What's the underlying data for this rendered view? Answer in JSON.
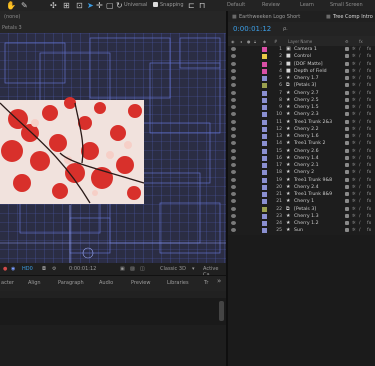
{
  "toolbar": {
    "selection_tool": "selection-arrow",
    "universal_label": "Universal",
    "snapping_label": "Snapping",
    "workspaces": [
      "Default",
      "Review",
      "Learn",
      "Small Screen"
    ]
  },
  "viewer": {
    "composition_label": "(none)",
    "breadcrumb": "Petals 3",
    "footer": {
      "time": "0:00:01:12",
      "renderer": "Classic 3D",
      "active_camera": "Active Ca",
      "draft_label": "HD0"
    }
  },
  "panels": {
    "tabs": [
      "acter",
      "Align",
      "Paragraph",
      "Audio",
      "Preview",
      "Libraries",
      "Tr"
    ],
    "more": "»"
  },
  "timeline": {
    "tabs": [
      "Earthweeken Logo Short",
      "Tree Comp Intro"
    ],
    "timecode": "0:00:01:12",
    "search_placeholder": "ρ.",
    "column_header": {
      "number": "#",
      "layer_name": "Layer Name"
    },
    "layers": [
      {
        "num": "1",
        "name": "Camera 1",
        "color": "#d94fa6",
        "icon": "camera"
      },
      {
        "num": "2",
        "name": "Control",
        "color": "#e8c845",
        "icon": "solid"
      },
      {
        "num": "3",
        "name": "[DOF Matte]",
        "color": "#d94fa6",
        "icon": "solid"
      },
      {
        "num": "4",
        "name": "Depth of Field",
        "color": "#d94fa6",
        "icon": "solid"
      },
      {
        "num": "5",
        "name": "Cherry 1.7",
        "color": "#8a8fd1",
        "icon": "star"
      },
      {
        "num": "6",
        "name": "[Petals 3]",
        "color": "#9aa04f",
        "icon": "comp"
      },
      {
        "num": "7",
        "name": "Cherry 2.7",
        "color": "#8a8fd1",
        "icon": "star"
      },
      {
        "num": "8",
        "name": "Cherry 2.5",
        "color": "#8a8fd1",
        "icon": "star"
      },
      {
        "num": "9",
        "name": "Cherry 1.5",
        "color": "#8a8fd1",
        "icon": "star"
      },
      {
        "num": "10",
        "name": "Cherry 2.3",
        "color": "#8a8fd1",
        "icon": "star"
      },
      {
        "num": "11",
        "name": "Tree1 Trunk 2&3",
        "color": "#8a8fd1",
        "icon": "star"
      },
      {
        "num": "12",
        "name": "Cherry 2.2",
        "color": "#8a8fd1",
        "icon": "star"
      },
      {
        "num": "13",
        "name": "Cherry 1.6",
        "color": "#8a8fd1",
        "icon": "star"
      },
      {
        "num": "14",
        "name": "Tree1 Trunk 2",
        "color": "#8a8fd1",
        "icon": "star"
      },
      {
        "num": "15",
        "name": "Cherry 2.6",
        "color": "#8a8fd1",
        "icon": "star"
      },
      {
        "num": "16",
        "name": "Cherry 1.4",
        "color": "#8a8fd1",
        "icon": "star"
      },
      {
        "num": "17",
        "name": "Cherry 2.1",
        "color": "#8a8fd1",
        "icon": "star"
      },
      {
        "num": "18",
        "name": "Cherry 2",
        "color": "#8a8fd1",
        "icon": "star"
      },
      {
        "num": "19",
        "name": "Tree1 Trunk 9&8",
        "color": "#8a8fd1",
        "icon": "star"
      },
      {
        "num": "20",
        "name": "Cherry 2.4",
        "color": "#8a8fd1",
        "icon": "star"
      },
      {
        "num": "21",
        "name": "Tree1 Trunk 8&9",
        "color": "#8a8fd1",
        "icon": "star"
      },
      {
        "num": "21",
        "name": "Cherry 1",
        "color": "#8a8fd1",
        "icon": "star"
      },
      {
        "num": "22",
        "name": "[Petals 3]",
        "color": "#9aa04f",
        "icon": "comp"
      },
      {
        "num": "23",
        "name": "Cherry 1.3",
        "color": "#8a8fd1",
        "icon": "star"
      },
      {
        "num": "24",
        "name": "Cherry 1.2",
        "color": "#8a8fd1",
        "icon": "star"
      },
      {
        "num": "25",
        "name": "Sun",
        "color": "#8a8fd1",
        "icon": "star"
      }
    ]
  },
  "colors": {
    "accent_blue": "#3c9ee6",
    "panel_bg": "#1d1d1d",
    "wireframe": "#5c6fd6",
    "petal_red": "#d8302b"
  }
}
